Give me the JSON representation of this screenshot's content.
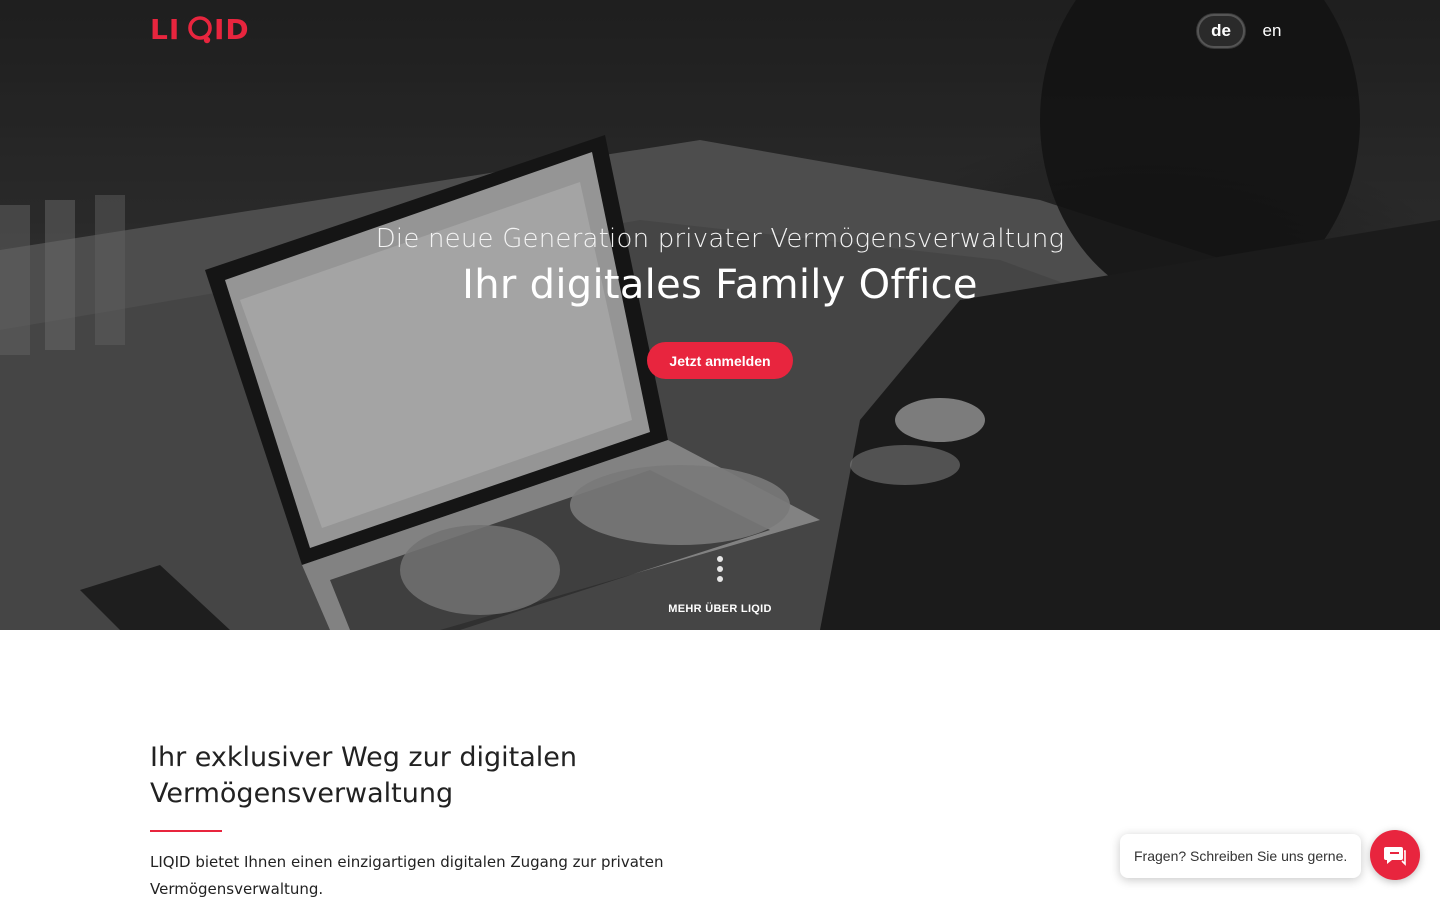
{
  "header": {
    "logo_text": "LIQID",
    "languages": [
      {
        "code": "de",
        "active": true
      },
      {
        "code": "en",
        "active": false
      }
    ]
  },
  "hero": {
    "subtitle": "Die neue Generation privater Vermögensverwaltung",
    "title": "Ihr digitales Family Office",
    "cta_label": "Jetzt anmelden",
    "more_label": "MEHR ÜBER LIQID"
  },
  "intro": {
    "title_line1": "Ihr exklusiver Weg zur digitalen",
    "title_line2": "Vermögensverwaltung",
    "text_line1": "LIQID bietet Ihnen einen einzigartigen digitalen Zugang zur privaten",
    "text_line2": "Vermögensverwaltung."
  },
  "chat": {
    "bubble_text": "Fragen? Schreiben Sie uns gerne.",
    "icon": "chat-icon"
  },
  "colors": {
    "brand_red": "#e8253e",
    "text_dark": "#222222",
    "hero_overlay": "#000000"
  }
}
